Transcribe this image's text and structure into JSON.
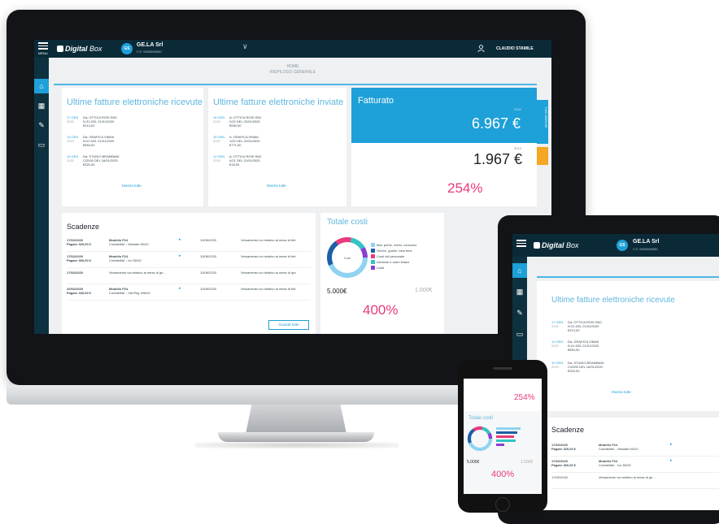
{
  "app": {
    "logo_bold": "Digital",
    "logo_light": "Box",
    "menu_label": "MENU",
    "company_badge": "GS",
    "company_name": "GE.LA Srl",
    "company_cf": "C.F. 0000000000",
    "user_name": "CLAUDIO STAMILE"
  },
  "breadcrumb": {
    "title": "HOME",
    "subtitle": "RIEPILOGO GENERALE"
  },
  "ricevute": {
    "title": "Ultime fatture elettroniche ricevute",
    "rows": [
      {
        "date": "17 GEN",
        "year": "2020",
        "text": "Da: OTTICA ROSI SNC\nN.31 DEL 21/01/2020\n€213,00"
      },
      {
        "date": "13 GEN",
        "year": "2020",
        "text": "Da: GRAFICA VIMAK\nN.01 DEL 21/01/2020\n€854,00"
      },
      {
        "date": "10 GEN",
        "year": "2020",
        "text": "Da: STUDIO BRAMBANI\nC/2000 DEL 16/01/2020\n€320,00"
      }
    ],
    "show_all": "Mostra tutte"
  },
  "inviate": {
    "title": "Ultime fatture elettroniche inviate",
    "rows": [
      {
        "date": "16 GEN",
        "year": "2020",
        "text": "A: OTTICA ROSI SNC\n2/22 DEL 22/01/2020\n€590,00"
      },
      {
        "date": "15 GEN",
        "year": "2020",
        "text": "A: GRAFICA VIMAK\n1/22 DEL 22/01/2020\n€771,00"
      },
      {
        "date": "12 GEN",
        "year": "2020",
        "text": "A: OTTICA ROSI SNC\n4/21 DEL 21/01/2020\n€18,00"
      }
    ],
    "show_all": "Mostra tutte"
  },
  "fatturato": {
    "title": "Fatturato",
    "label_current": "2020",
    "value_current": "6.967 €",
    "label_previous": "2019",
    "value_previous": "1.967 €",
    "percent": "254%"
  },
  "side_tabs": {
    "tab1": "TUOI SERVIZI",
    "tab2": ""
  },
  "scadenze": {
    "title": "Scadenze",
    "rows": [
      {
        "date": "17/02/2020",
        "amount": "Pagare 320,00 €",
        "model": "Modello F24",
        "desc": "Contabilita' - Maniate 60/20",
        "date2": "10/06/2020",
        "note": "Versamento ivo relativo al mese di feb"
      },
      {
        "date": "17/02/2020",
        "amount": "Pagare 360,00 €",
        "model": "Modello F24",
        "desc": "Contabilita' - Ivn 50/20",
        "date2": "10/06/2020",
        "note": "Versamento ivo relativo al mese di feb"
      },
      {
        "date": "17/02/2020",
        "amount": "",
        "model": "Versamento iva relativo al mese di ge...",
        "desc": "",
        "date2": "10/06/2020",
        "note": "Versamento ivo relativo al mese di apr"
      },
      {
        "date": "20/02/2020",
        "amount": "Pagare 440,00 €",
        "model": "Modello F24",
        "desc": "Contabilita' - Via Reg 496/20",
        "date2": "10/06/2020",
        "note": "Versamento ivo relativo al mese di feb"
      }
    ],
    "button": "Guarda tutte"
  },
  "costi": {
    "title": "Totale costi",
    "donut_label": "Costi",
    "legend": [
      {
        "label": "Mat. prime, merci, consumo",
        "color": "#8fd3f0"
      },
      {
        "label": "Servizi, godim. beni terzi",
        "color": "#1e5fa8"
      },
      {
        "label": "Costi del personale",
        "color": "#e93a7d"
      },
      {
        "label": "Interessi e oneri finanz.",
        "color": "#35c4c4"
      },
      {
        "label": "Costi",
        "color": "#8a3fd1"
      }
    ],
    "value_current": "5.000€",
    "value_previous": "1.000€",
    "percent": "400%"
  },
  "tablet": {
    "logo_bold": "Digital",
    "logo_light": "Box",
    "company_name": "GE.LA Srl",
    "company_cf": "C.F. 0000000000",
    "title": "Ultime fatture elettroniche ricevute",
    "rows": [
      {
        "date": "17 GEN",
        "year": "2020",
        "text": "Da: OTTICA ROSI SNC\nN.31 DEL 21/01/2020\n€213,00"
      },
      {
        "date": "13 GEN",
        "year": "2020",
        "text": "Da: GRAFICA VIMAK\nN.01 DEL 21/01/2020\n€854,00"
      },
      {
        "date": "10 GEN",
        "year": "2020",
        "text": "Da: STUDIO BRAMBANI\nC/2000 DEL 16/01/2020\n€320,00"
      }
    ],
    "show_all": "Mostra tutte",
    "scadenze_title": "Scadenze",
    "scad_rows": [
      {
        "date": "17/02/2020",
        "amount": "Pagare 320,00 €",
        "model": "Modello F24",
        "desc": "Contabilita' - Maniate 60/20"
      },
      {
        "date": "17/02/2020",
        "amount": "Pagare 360,00 €",
        "model": "Modello F24",
        "desc": "Contabilita' - Ivn 50/20"
      },
      {
        "date": "17/02/2020",
        "amount": "",
        "model": "Versamento iva relativo al mese di ge...",
        "desc": ""
      }
    ]
  },
  "phone": {
    "percent_top": "254%",
    "costi_title": "Totale costi",
    "value_current": "5.000€",
    "value_previous": "1.000€",
    "percent": "400%"
  }
}
